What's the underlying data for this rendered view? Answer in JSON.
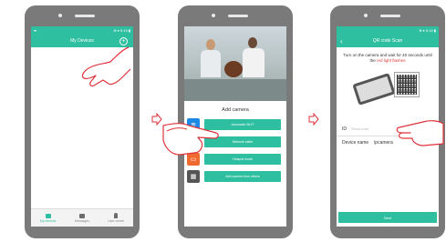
{
  "colors": {
    "accent": "#2dbfa0",
    "phone_frame": "#7a7a7a",
    "warn": "#e23b3b"
  },
  "step1": {
    "status_left": "▾▪",
    "status_right": "⊕ ▾ 5:19 ▮",
    "title": "My Devices",
    "add_icon": "plus-icon",
    "tabs": [
      {
        "label": "My devices",
        "icon": "camera-icon"
      },
      {
        "label": "Messages",
        "icon": "message-icon"
      },
      {
        "label": "User center",
        "icon": "user-icon"
      }
    ]
  },
  "step2": {
    "title": "Add camera",
    "options": [
      {
        "icon": "wifi-icon",
        "color": "#1e88e5",
        "label": "Automatic Wi-Fi"
      },
      {
        "icon": "ethernet-icon",
        "color": "#2dbfa0",
        "label": "Network cable"
      },
      {
        "icon": "router-icon",
        "color": "#f0692e",
        "label": "Hotspot mode"
      },
      {
        "icon": "keyboard-icon",
        "color": "#555555",
        "label": "Add camera from others"
      }
    ]
  },
  "step3": {
    "status_right": "⊕ ▾ 5:19 ▮",
    "title": "QR code Scan",
    "instruction_main": "Turn on the camera and wait for 40 seconds until the ",
    "instruction_red": "red light flashes",
    "id_label": "ID",
    "id_placeholder": "Please enter",
    "device_name_label": "Device name",
    "device_name_value": "ipcamera",
    "next_button": "Next"
  }
}
